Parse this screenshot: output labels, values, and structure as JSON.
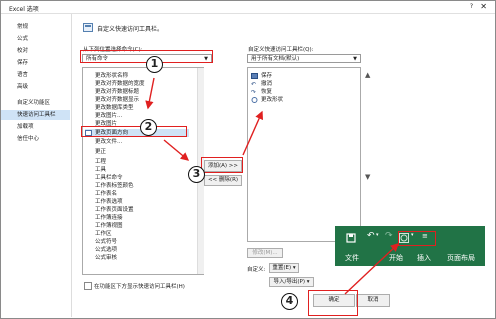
{
  "window": {
    "title": "Excel 选项",
    "help": "?",
    "close": "✕"
  },
  "sidebar": {
    "items": [
      {
        "label": "常规"
      },
      {
        "label": "公式"
      },
      {
        "label": "校对"
      },
      {
        "label": "保存"
      },
      {
        "label": "语言"
      },
      {
        "label": "高级"
      },
      {
        "label": "自定义功能区"
      },
      {
        "label": "快速访问工具栏"
      },
      {
        "label": "加载项"
      },
      {
        "label": "信任中心"
      }
    ],
    "selected_index": 7
  },
  "header": {
    "heading": "自定义快速访问工具栏。"
  },
  "left": {
    "choose_label": "从下列位置选择命令(C):",
    "choose_value": "所有命令",
    "commands": [
      "更改形状名称",
      "更改对齐数据的宽度",
      "更改对齐数据标题",
      "更改对齐数据显示",
      "更改数据库类型",
      "更改图片...",
      "更改图片",
      "更改页面方向",
      "更改文件...",
      "更正",
      "工程",
      "工具",
      "工具栏命令",
      "工作表标签颜色",
      "工作表名",
      "工作表选项",
      "工作表页面设置",
      "工作簿连接",
      "工作簿视图",
      "工作区",
      "公式符号",
      "公式选项",
      "公式审核"
    ],
    "show_below_label": "在功能区下方显示快速访问工具栏(H)"
  },
  "middle": {
    "add_label": "添加(A) >>",
    "remove_label": "<< 删除(R)"
  },
  "right": {
    "customize_label": "自定义快速访问工具栏(Q):",
    "customize_value": "用于所有文档(默认)",
    "items": [
      "保存",
      "撤消",
      "恢复",
      "更改形状"
    ],
    "modify_label": "修改(M)...",
    "custom_label": "自定义:",
    "reset_label": "重置(E) ▾",
    "import_label": "导入/导出(P) ▾"
  },
  "footer": {
    "ok_label": "确定",
    "cancel_label": "取消"
  },
  "ribbon_preview": {
    "tabs": [
      "文件",
      "开始",
      "插入",
      "页面布局"
    ]
  },
  "annotations": [
    "1",
    "2",
    "3",
    "4"
  ]
}
